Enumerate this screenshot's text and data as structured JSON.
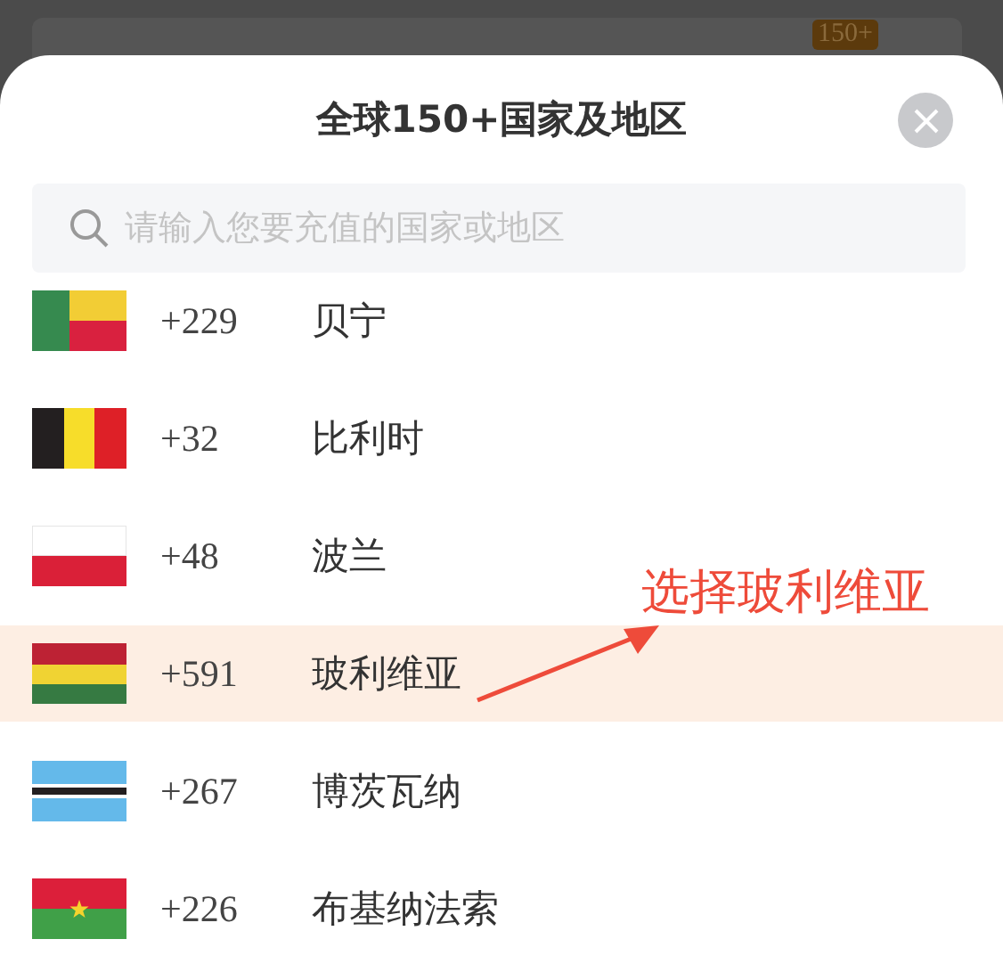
{
  "background": {
    "badge": "150+"
  },
  "sheet": {
    "title": "全球150+国家及地区",
    "search": {
      "placeholder": "请输入您要充值的国家或地区"
    },
    "countries": [
      {
        "kind": "benin",
        "code": "+229",
        "name": "贝宁",
        "selected": false
      },
      {
        "kind": "belgium",
        "code": "+32",
        "name": "比利时",
        "selected": false
      },
      {
        "kind": "poland",
        "code": "+48",
        "name": "波兰",
        "selected": false
      },
      {
        "kind": "bolivia",
        "code": "+591",
        "name": "玻利维亚",
        "selected": true
      },
      {
        "kind": "botswana",
        "code": "+267",
        "name": "博茨瓦纳",
        "selected": false
      },
      {
        "kind": "burkina",
        "code": "+226",
        "name": "布基纳法索",
        "selected": false
      }
    ]
  },
  "annotation": {
    "text": "选择玻利维亚"
  }
}
